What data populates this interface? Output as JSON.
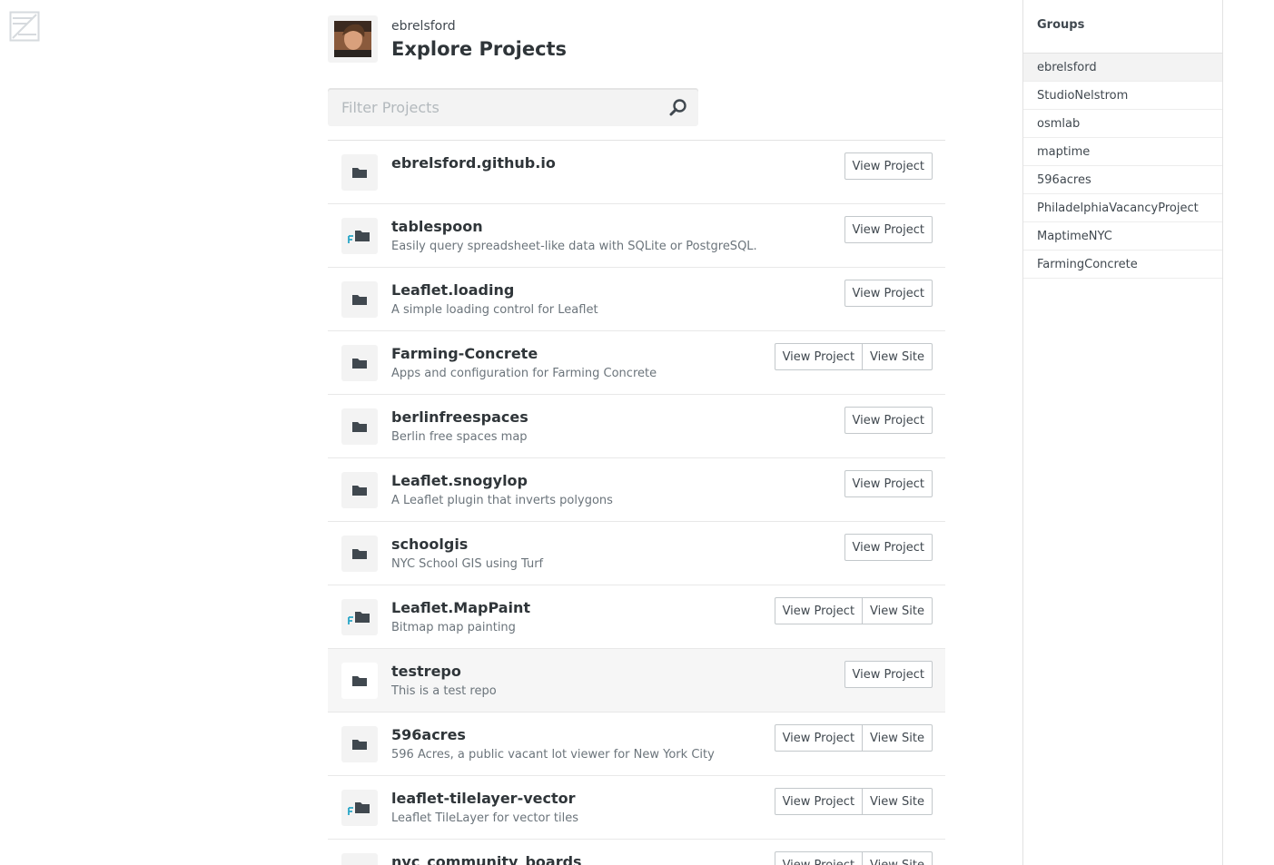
{
  "user": {
    "username": "ebrelsford"
  },
  "page": {
    "title": "Explore Projects"
  },
  "filter": {
    "placeholder": "Filter Projects",
    "value": ""
  },
  "buttons": {
    "view_project": "View Project",
    "view_site": "View Site"
  },
  "projects": [
    {
      "name": "ebrelsford.github.io",
      "description": "",
      "icon": "folder-icon",
      "has_site": false
    },
    {
      "name": "tablespoon",
      "description": "Easily query spreadsheet-like data with SQLite or PostgreSQL.",
      "icon": "forked-folder-icon",
      "has_site": false
    },
    {
      "name": "Leaflet.loading",
      "description": "A simple loading control for Leaflet",
      "icon": "folder-icon",
      "has_site": false
    },
    {
      "name": "Farming-Concrete",
      "description": "Apps and configuration for Farming Concrete",
      "icon": "folder-icon",
      "has_site": true
    },
    {
      "name": "berlinfreespaces",
      "description": "Berlin free spaces map",
      "icon": "folder-icon",
      "has_site": false
    },
    {
      "name": "Leaflet.snogylop",
      "description": "A Leaflet plugin that inverts polygons",
      "icon": "folder-icon",
      "has_site": false
    },
    {
      "name": "schoolgis",
      "description": "NYC School GIS using Turf",
      "icon": "folder-icon",
      "has_site": false
    },
    {
      "name": "Leaflet.MapPaint",
      "description": "Bitmap map painting",
      "icon": "forked-folder-icon",
      "has_site": true
    },
    {
      "name": "testrepo",
      "description": "This is a test repo",
      "icon": "folder-icon",
      "has_site": false
    },
    {
      "name": "596acres",
      "description": "596 Acres, a public vacant lot viewer for New York City",
      "icon": "folder-icon",
      "has_site": true
    },
    {
      "name": "leaflet-tilelayer-vector",
      "description": "Leaflet TileLayer for vector tiles",
      "icon": "forked-folder-icon",
      "has_site": true
    },
    {
      "name": "nyc_community_boards",
      "description": "",
      "icon": "folder-icon",
      "has_site": true
    }
  ],
  "sidebar": {
    "title": "Groups",
    "groups": [
      "ebrelsford",
      "StudioNelstrom",
      "osmlab",
      "maptime",
      "596acres",
      "PhiladelphiaVacancyProject",
      "MaptimeNYC",
      "FarmingConcrete"
    ]
  },
  "colors": {
    "text": "#40484f",
    "heading": "#2f3539",
    "muted": "#6b747b",
    "fork_accent": "#2aa6c7",
    "panel": "#f3f3f3"
  }
}
